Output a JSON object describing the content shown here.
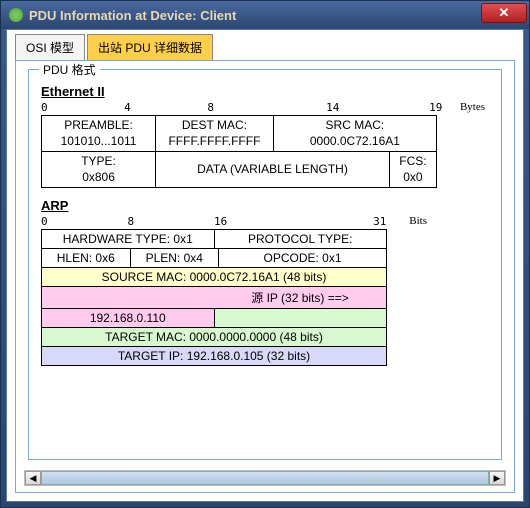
{
  "window": {
    "title": "PDU Information at Device: Client"
  },
  "tabs": {
    "osi_label": "OSI 模型",
    "outbound_label": "出站 PDU 详细数据"
  },
  "fieldset_legend": "PDU 格式",
  "ethernet": {
    "title": "Ethernet II",
    "scale": {
      "p0": "0",
      "p4": "4",
      "p8": "8",
      "p14": "14",
      "p19": "19",
      "unit": "Bytes"
    },
    "preamble_label": "PREAMBLE:",
    "preamble_value": "101010...1011",
    "destmac_label": "DEST MAC:",
    "destmac_value": "FFFF.FFFF.FFFF",
    "srcmac_label": "SRC MAC:",
    "srcmac_value": "0000.0C72.16A1",
    "type_label": "TYPE:",
    "type_value": "0x806",
    "data_label": "DATA (VARIABLE LENGTH)",
    "fcs_label": "FCS:",
    "fcs_value": "0x0"
  },
  "arp": {
    "title": "ARP",
    "scale": {
      "p0": "0",
      "p8": "8",
      "p16": "16",
      "p31": "31",
      "unit": "Bits"
    },
    "hwtype": "HARDWARE TYPE: 0x1",
    "ptype": "PROTOCOL TYPE:",
    "hlen": "HLEN: 0x6",
    "plen": "PLEN: 0x4",
    "opcode": "OPCODE: 0x1",
    "srcmac": "SOURCE MAC: 0000.0C72.16A1 (48 bits)",
    "srcip_label": "源 IP (32 bits) ==>",
    "srcip_value": "192.168.0.110",
    "tgtmac": "TARGET MAC: 0000.0000.0000 (48 bits)",
    "tgtip": "TARGET IP: 192.168.0.105 (32 bits)"
  }
}
